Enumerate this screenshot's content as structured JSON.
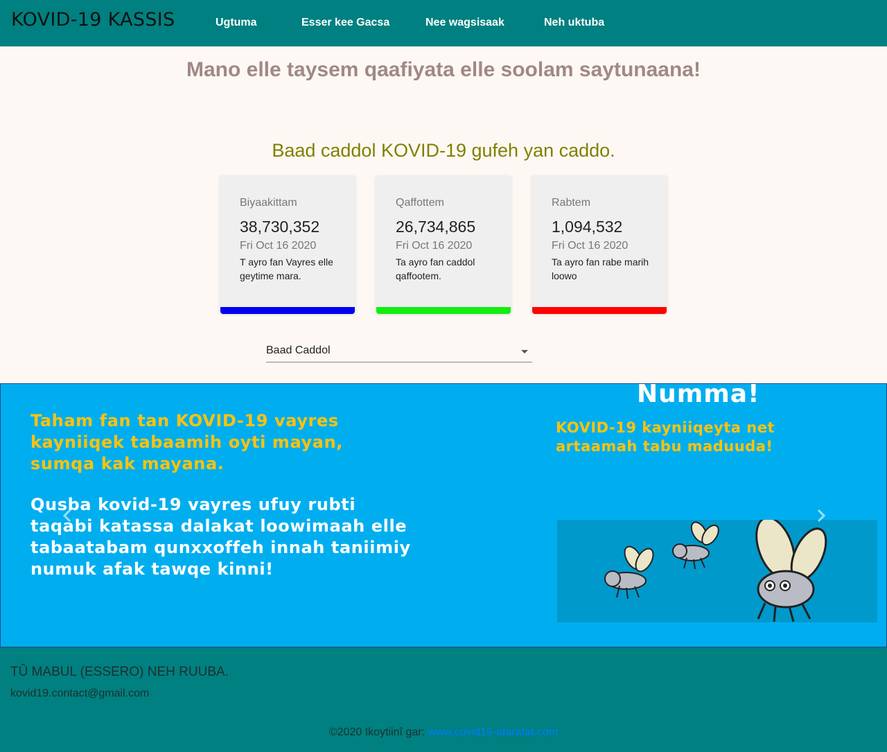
{
  "nav": {
    "brand": "KOVID-19 KASSIS",
    "links": [
      "Ugtuma",
      "Esser kee Gacsa",
      "Nee wagsisaak",
      "Neh uktuba"
    ]
  },
  "hero": {
    "welcome": "Mano elle taysem qaafiyata elle soolam saytunaana!",
    "subtitle": "Baad caddol KOVID-19 gufeh yan caddo."
  },
  "cards": [
    {
      "label": "Biyaakittam",
      "count": "38,730,352",
      "date": "Fri Oct 16 2020",
      "desc": "T ayro fan Vayres elle geytime mara.",
      "color": "#0000ee"
    },
    {
      "label": "Qaffottem",
      "count": "26,734,865",
      "date": "Fri Oct 16 2020",
      "desc": "Ta ayro fan caddol qaffootem.",
      "color": "#11ee11"
    },
    {
      "label": "Rabtem",
      "count": "1,094,532",
      "date": "Fri Oct 16 2020",
      "desc": "Ta ayro fan rabe marih loowo",
      "color": "#ff0000"
    }
  ],
  "country_select": {
    "value": "Baad Caddol"
  },
  "carousel": {
    "left_yellow": [
      "Taham fan tan KOVID-19 vayres",
      "kayniiqek tabaamih oyti mayan,",
      "sumqa kak mayana."
    ],
    "left_white": [
      "Qusba kovid-19 vayres ufuy rubti",
      "taqabi katassa dalakat loowimaah elle",
      "tabaatabam qunxxoffeh innah taniimiy",
      "numuk afak tawqe kinni!"
    ],
    "right_title": "Numma!",
    "right_yellow": [
      "KOVID-19 kayniiqeyta net",
      "artaamah tabu maduuda!"
    ],
    "prev_icon": "chevron-left-icon",
    "next_icon": "chevron-right-icon"
  },
  "footer": {
    "title": "TÛ MABUL (ESSERO) NEH RUUBA.",
    "email": "kovid19.contact@gmail.com",
    "copyright": "©2020 Ikoytiinî gar: ",
    "link": "www.covid19-afarafat.com"
  }
}
